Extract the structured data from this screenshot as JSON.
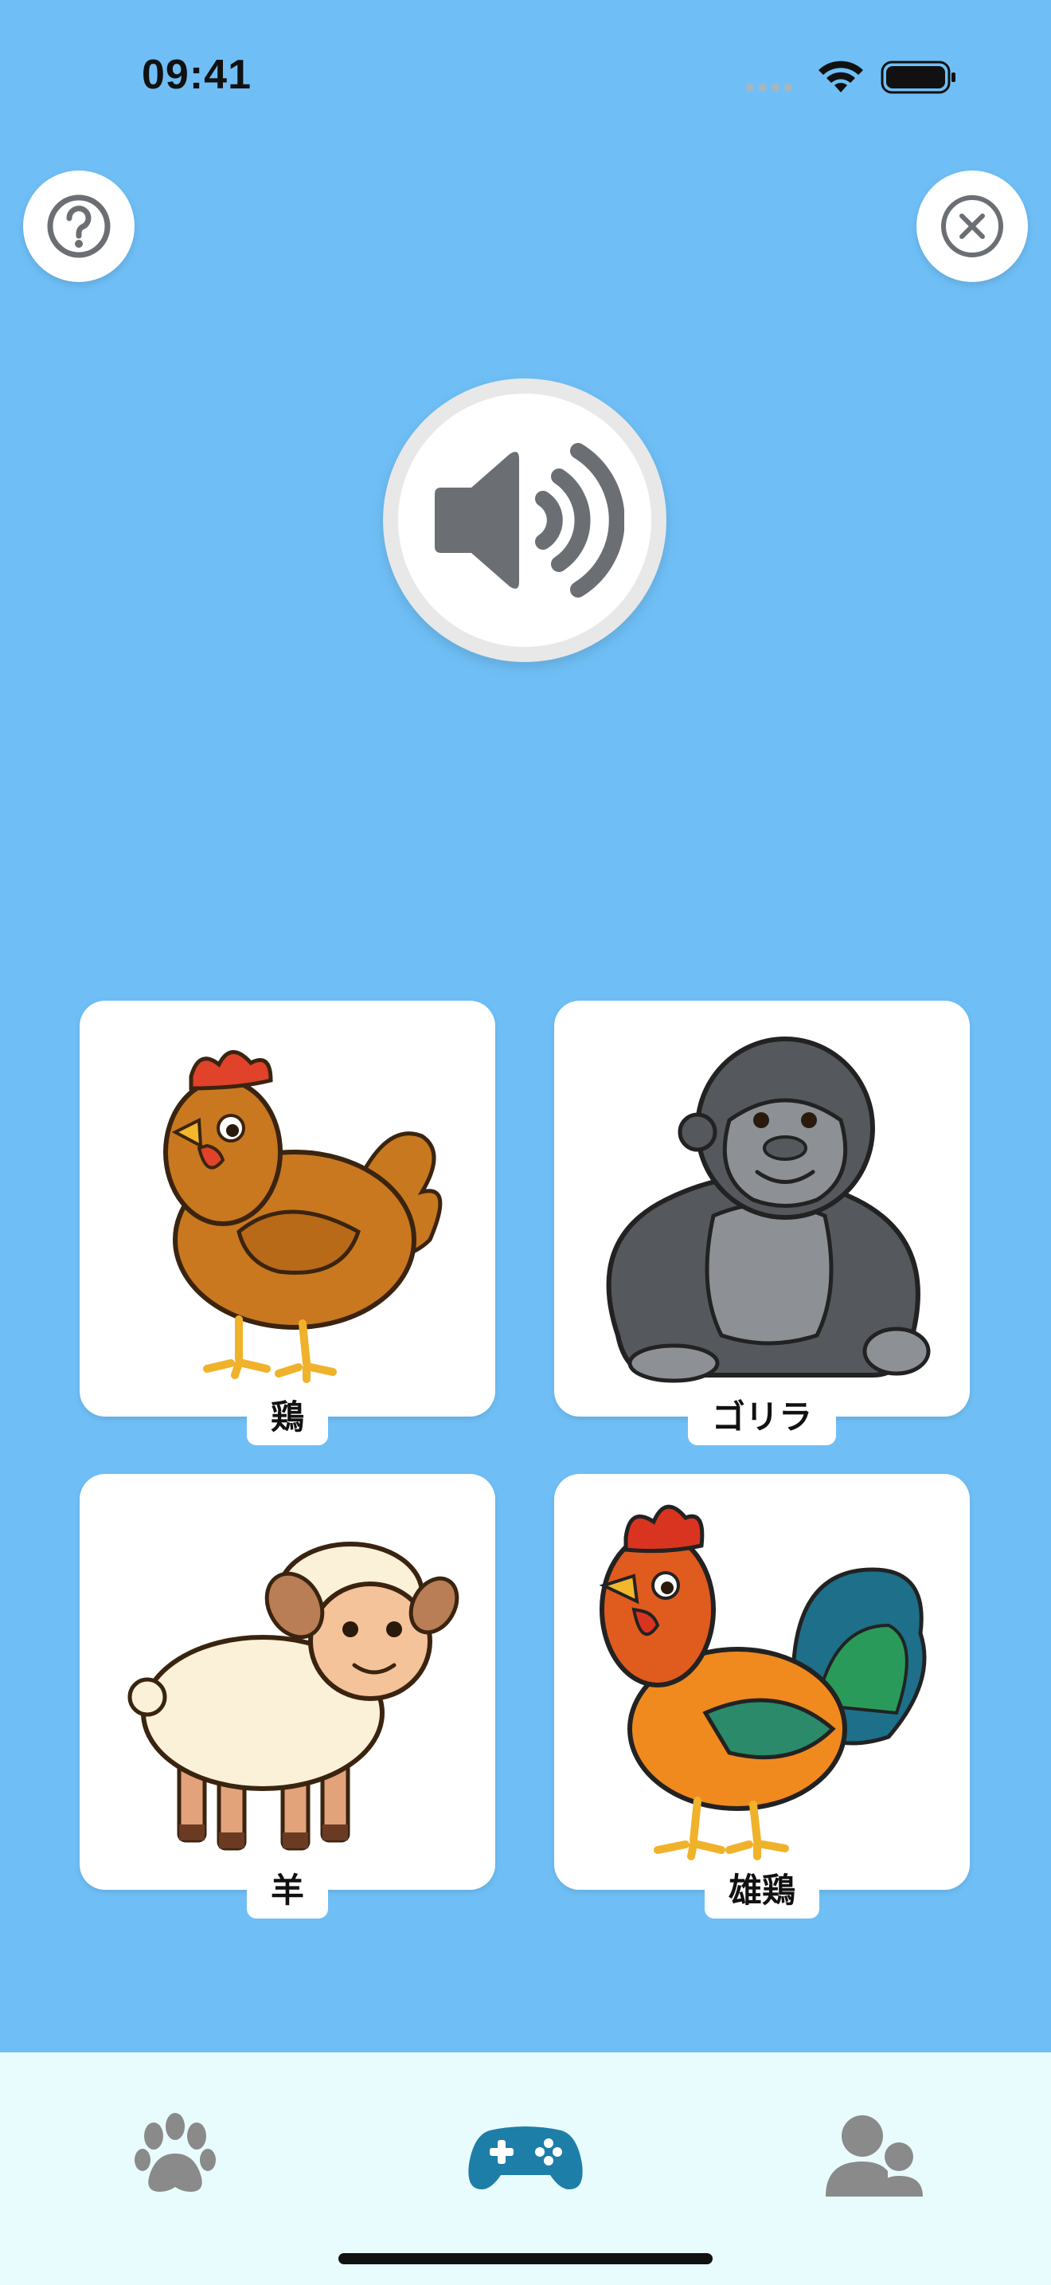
{
  "status_bar": {
    "time": "09:41",
    "icons": [
      "signal-icon",
      "wifi-icon",
      "battery-icon"
    ]
  },
  "top_bar": {
    "help_icon": "question-circle-icon",
    "close_icon": "close-circle-icon"
  },
  "sound_button": {
    "icon": "speaker-wave-icon"
  },
  "cards": [
    {
      "label": "鶏",
      "image": "hen"
    },
    {
      "label": "ゴリラ",
      "image": "gorilla"
    },
    {
      "label": "羊",
      "image": "sheep"
    },
    {
      "label": "雄鶏",
      "image": "rooster"
    }
  ],
  "tabbar": {
    "tabs": [
      {
        "icon": "paw-icon",
        "active": false
      },
      {
        "icon": "gamepad-icon",
        "active": true
      },
      {
        "icon": "users-icon",
        "active": false
      }
    ]
  },
  "colors": {
    "background": "#6fbff6",
    "card": "#ffffff",
    "icon_gray": "#6b6f73",
    "tab_active": "#1d7ea8",
    "tab_inactive": "#8a8a8a",
    "tabbar": "#e9fcfd"
  }
}
